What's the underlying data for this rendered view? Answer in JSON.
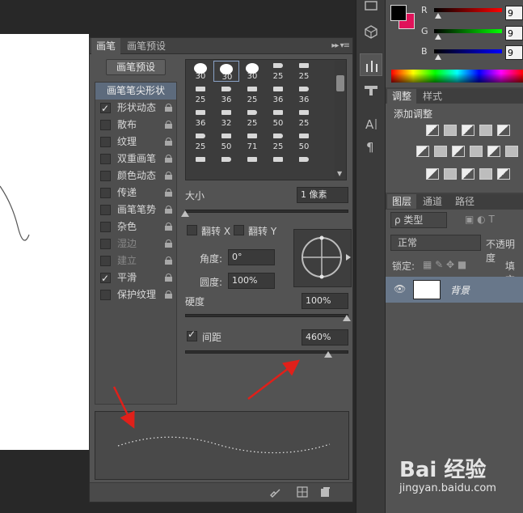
{
  "brush_panel": {
    "tabs": [
      "画笔",
      "画笔预设"
    ],
    "menu_glyph": "▸▸ ▾≡",
    "preset_button": "画笔预设",
    "tip_shape_label": "画笔笔尖形状",
    "options": [
      {
        "label": "形状动态",
        "checked": true,
        "disabled": false
      },
      {
        "label": "散布",
        "checked": false,
        "disabled": false
      },
      {
        "label": "纹理",
        "checked": false,
        "disabled": false
      },
      {
        "label": "双重画笔",
        "checked": false,
        "disabled": false
      },
      {
        "label": "颜色动态",
        "checked": false,
        "disabled": false
      },
      {
        "label": "传递",
        "checked": false,
        "disabled": false
      },
      {
        "label": "画笔笔势",
        "checked": false,
        "disabled": false
      },
      {
        "label": "杂色",
        "checked": false,
        "disabled": false
      },
      {
        "label": "湿边",
        "checked": false,
        "disabled": true
      },
      {
        "label": "建立",
        "checked": false,
        "disabled": true
      },
      {
        "label": "平滑",
        "checked": true,
        "disabled": false
      },
      {
        "label": "保护纹理",
        "checked": false,
        "disabled": false
      }
    ],
    "tip_sizes": [
      "30",
      "30",
      "30",
      "25",
      "25",
      "25",
      "36",
      "25",
      "36",
      "36",
      "36",
      "32",
      "25",
      "50",
      "25",
      "25",
      "50",
      "71",
      "25",
      "50",
      "",
      "",
      "",
      "",
      ""
    ],
    "size_label": "大小",
    "size_value": "1 像素",
    "flip_x_label": "翻转 X",
    "flip_y_label": "翻转 Y",
    "angle_label": "角度:",
    "angle_value": "0°",
    "roundness_label": "圆度:",
    "roundness_value": "100%",
    "hardness_label": "硬度",
    "hardness_value": "100%",
    "spacing_label": "间距",
    "spacing_value": "460%",
    "spacing_checked": true
  },
  "color_panel": {
    "foreground": "#000000",
    "background": "#e0135a",
    "channels": [
      {
        "label": "R",
        "value": "9"
      },
      {
        "label": "G",
        "value": "9"
      },
      {
        "label": "B",
        "value": "9"
      }
    ]
  },
  "adjust_panel": {
    "tabs": [
      "调整",
      "样式"
    ],
    "title": "添加调整"
  },
  "layers_panel": {
    "tabs": [
      "图层",
      "通道",
      "路径"
    ],
    "kind": "ρ 类型",
    "blend_mode": "正常",
    "opacity_label": "不透明度",
    "lock_label": "锁定:",
    "fill_label": "填充",
    "layer_name": "背景"
  },
  "watermark": {
    "brand": "Bai 经验",
    "url": "jingyan.baidu.com"
  },
  "colors": {
    "arrow": "#e0201a",
    "selected_row": "#68778a",
    "panel_bg": "#535353"
  }
}
